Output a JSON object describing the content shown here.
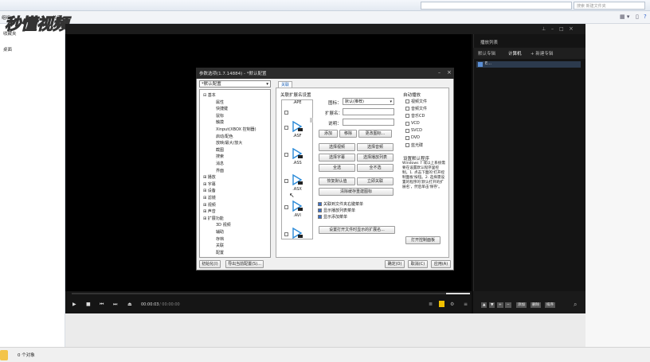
{
  "explorer": {
    "menu_left": "组织 ▾",
    "menu_share": "共享 ▾",
    "search_placeholder": "搜索 新建文件夹",
    "nav_favorites": "收藏夹",
    "nav_desktop": "桌面",
    "status_items": "0 个对象"
  },
  "watermark": "秒懂视频",
  "player": {
    "playlist_header": "播放列表",
    "tabs": [
      "默认专辑",
      "计算机",
      "+ 新建专辑"
    ],
    "playlist_item": "E...",
    "time_current": "00:00:03",
    "time_total": "/ 00:00:00",
    "playlist_buttons": [
      "添加",
      "删除",
      "排序"
    ]
  },
  "dialog": {
    "title": "参数选项(1.7.14884) - *默认配置",
    "profile": "*默认配置",
    "tree": [
      {
        "label": "基本",
        "level": 0,
        "expanded": true
      },
      {
        "label": "属性",
        "level": 1
      },
      {
        "label": "快捷键",
        "level": 1
      },
      {
        "label": "鼠标",
        "level": 1
      },
      {
        "label": "触摸",
        "level": 1
      },
      {
        "label": "Xinput(XBOX 控制器)",
        "level": 1
      },
      {
        "label": "启动/配色",
        "level": 1
      },
      {
        "label": "放映/最大/放大",
        "level": 1
      },
      {
        "label": "截图",
        "level": 1
      },
      {
        "label": "搜索",
        "level": 1
      },
      {
        "label": "消息",
        "level": 1
      },
      {
        "label": "界面",
        "level": 1
      },
      {
        "label": "播放",
        "level": 0
      },
      {
        "label": "字幕",
        "level": 0
      },
      {
        "label": "设备",
        "level": 0
      },
      {
        "label": "滤镜",
        "level": 0
      },
      {
        "label": "视频",
        "level": 0
      },
      {
        "label": "声音",
        "level": 0
      },
      {
        "label": "扩展功能",
        "level": 0
      },
      {
        "label": "3D 视频",
        "level": 1
      },
      {
        "label": "辅助",
        "level": 1
      },
      {
        "label": "存档",
        "level": 1
      },
      {
        "label": "关联",
        "level": 1
      },
      {
        "label": "配置",
        "level": 1
      }
    ],
    "tab_label": "关联",
    "section_title": "关联扩展名设置",
    "extensions": [
      ".APE",
      ".ASF",
      ".ASS",
      ".ASX",
      ".AVI",
      ".CDA"
    ],
    "icon_label": "图标：",
    "icon_value": "默认(推荐)",
    "ext_label": "扩展名：",
    "desc_label": "说明：",
    "buttons_row1": [
      "添加",
      "移除",
      "更改图标..."
    ],
    "buttons_row2": [
      "选择视频",
      "选择音频"
    ],
    "buttons_row3": [
      "选择字幕",
      "选择播放列表"
    ],
    "buttons_row4": [
      "全选",
      "全不选"
    ],
    "buttons_row5": [
      "恢复默认值",
      "立即关联"
    ],
    "clear_cache": "清除缓存重建图标",
    "checkbox_context": "关联到文件夹右键菜单",
    "checkbox_playlist": "显示播放列表菜单",
    "checkbox_add": "显示添加菜单",
    "open_ext_button": "设置打开文件时显示的扩展名...",
    "autoplay_title": "自动播放",
    "autoplay_items": [
      "视频文件",
      "音频文件",
      "音乐CD",
      "VCD",
      "SVCD",
      "DVD",
      "蓝光碟"
    ],
    "default_title": "设置默认程序",
    "default_desc": "Windows 7 或以上系统需要在设置默认程序里控制。1. 点击下面的'打开控制面板'按钮。2. 选择需设置的程序的'默认打开的扩展名'，然后单击'保存'。",
    "open_cp_button": "打开控制面板",
    "init_button": "初始化(I)",
    "export_button": "导出当前配置(S)...",
    "ok_button": "确定(O)",
    "cancel_button": "取消(C)",
    "apply_button": "应用(A)"
  }
}
